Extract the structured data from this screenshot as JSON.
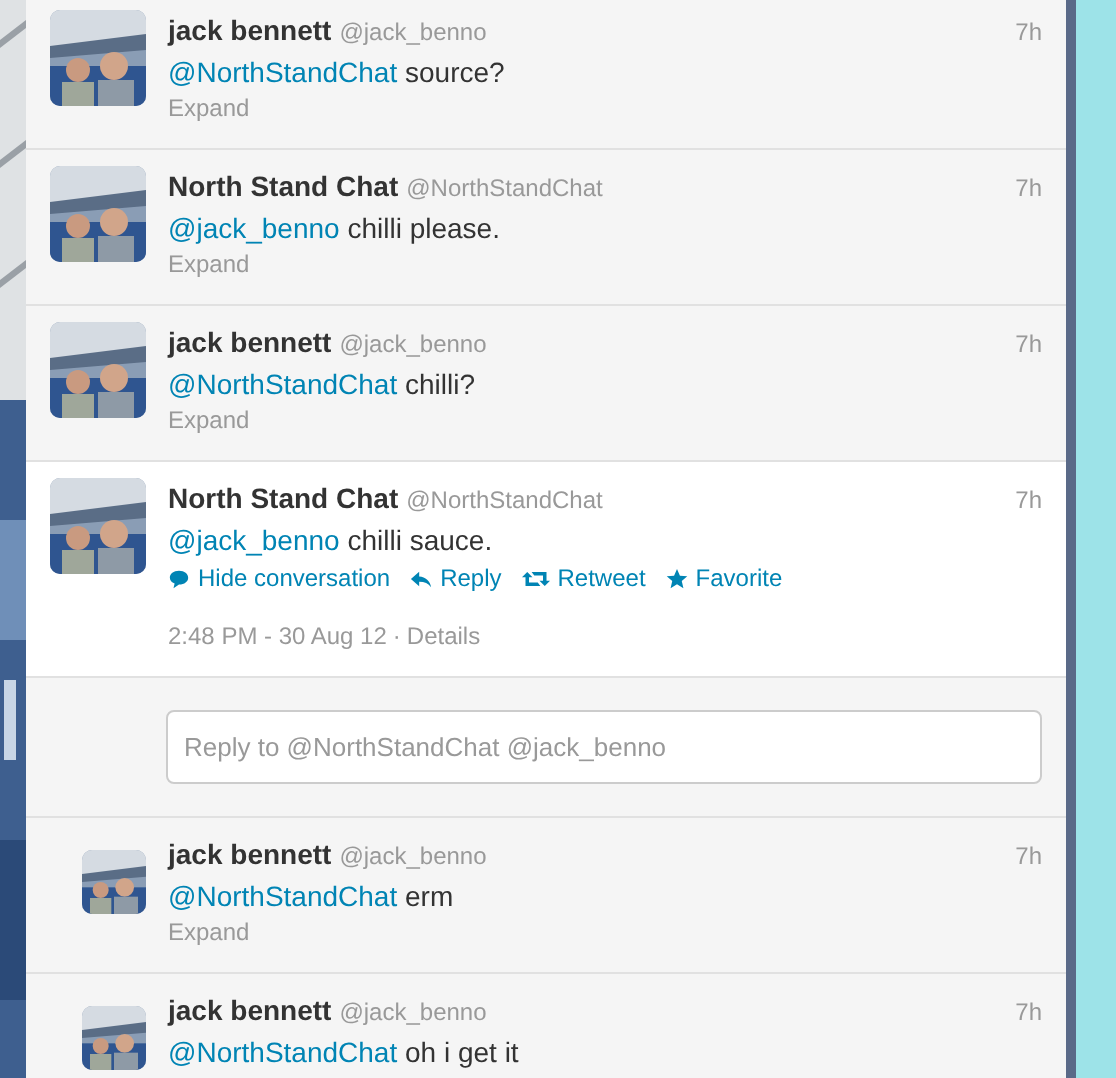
{
  "tweets": [
    {
      "kind": "compact",
      "name": "jack bennett",
      "handle": "@jack_benno",
      "time": "7h",
      "mention": "@NorthStandChat",
      "text": "source?",
      "expand": "Expand"
    },
    {
      "kind": "compact",
      "name": "North Stand Chat",
      "handle": "@NorthStandChat",
      "time": "7h",
      "mention": "@jack_benno",
      "text": "chilli please.",
      "expand": "Expand"
    },
    {
      "kind": "compact",
      "name": "jack bennett",
      "handle": "@jack_benno",
      "time": "7h",
      "mention": "@NorthStandChat",
      "text": "chilli?",
      "expand": "Expand"
    },
    {
      "kind": "expanded",
      "name": "North Stand Chat",
      "handle": "@NorthStandChat",
      "time": "7h",
      "mention": "@jack_benno",
      "text": "chilli sauce.",
      "actions": [
        {
          "kind": "conversation",
          "label": "Hide conversation"
        },
        {
          "kind": "reply",
          "label": "Reply"
        },
        {
          "kind": "retweet",
          "label": "Retweet"
        },
        {
          "kind": "favorite",
          "label": "Favorite"
        }
      ],
      "timestamp": "2:48 PM - 30 Aug 12",
      "separator": "·",
      "details": "Details",
      "reply_placeholder": "Reply to @NorthStandChat @jack_benno"
    },
    {
      "kind": "reply",
      "name": "jack bennett",
      "handle": "@jack_benno",
      "time": "7h",
      "mention": "@NorthStandChat",
      "text": "erm",
      "expand": "Expand"
    },
    {
      "kind": "reply",
      "name": "jack bennett",
      "handle": "@jack_benno",
      "time": "7h",
      "mention": "@NorthStandChat",
      "text": "oh i get it"
    }
  ]
}
